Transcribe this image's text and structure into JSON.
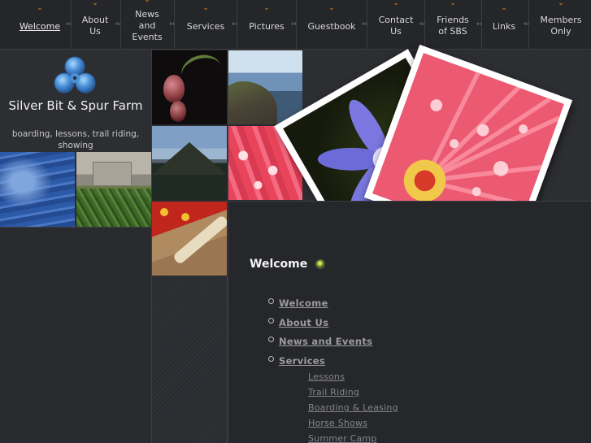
{
  "nav": {
    "items": [
      {
        "label": "Welcome",
        "active": true
      },
      {
        "label": "About\nUs"
      },
      {
        "label": "News\nand\nEvents"
      },
      {
        "label": "Services"
      },
      {
        "label": "Pictures"
      },
      {
        "label": "Guestbook"
      },
      {
        "label": "Contact\nUs"
      },
      {
        "label": "Friends\nof SBS"
      },
      {
        "label": "Links"
      },
      {
        "label": "Members\nOnly"
      }
    ],
    "chevron_glyph": "⌄",
    "separator_glyph": "↔",
    "accent_color": "#e2931d"
  },
  "site": {
    "title": "Silver Bit & Spur Farm",
    "subtitle": "boarding, lessons, trail riding, showing",
    "logo_icon": "trefoil-clover-icon",
    "logo_color": "#4a8fd6"
  },
  "content": {
    "heading": "Welcome",
    "heading_icon": "green-bullet-icon",
    "menu": [
      {
        "label": "Welcome"
      },
      {
        "label": "About Us"
      },
      {
        "label": "News and Events"
      },
      {
        "label": "Services"
      }
    ],
    "submenu": [
      {
        "label": "Lessons"
      },
      {
        "label": "Trail Riding"
      },
      {
        "label": "Boarding & Leasing"
      },
      {
        "label": "Horse Shows"
      },
      {
        "label": "Summer Camp"
      }
    ]
  },
  "photos": {
    "flower_buds": "flower-buds-photo",
    "coastline": "coastline-photo",
    "mountain": "mountain-photo",
    "pink_flower": "pink-flower-photo",
    "red_sand": "red-fabric-sand-photo",
    "sky": "blue-sky-photo",
    "village": "village-photo",
    "purple_flower_polaroid": "purple-flower-polaroid",
    "pink_gerbera_polaroid": "pink-gerbera-polaroid"
  }
}
